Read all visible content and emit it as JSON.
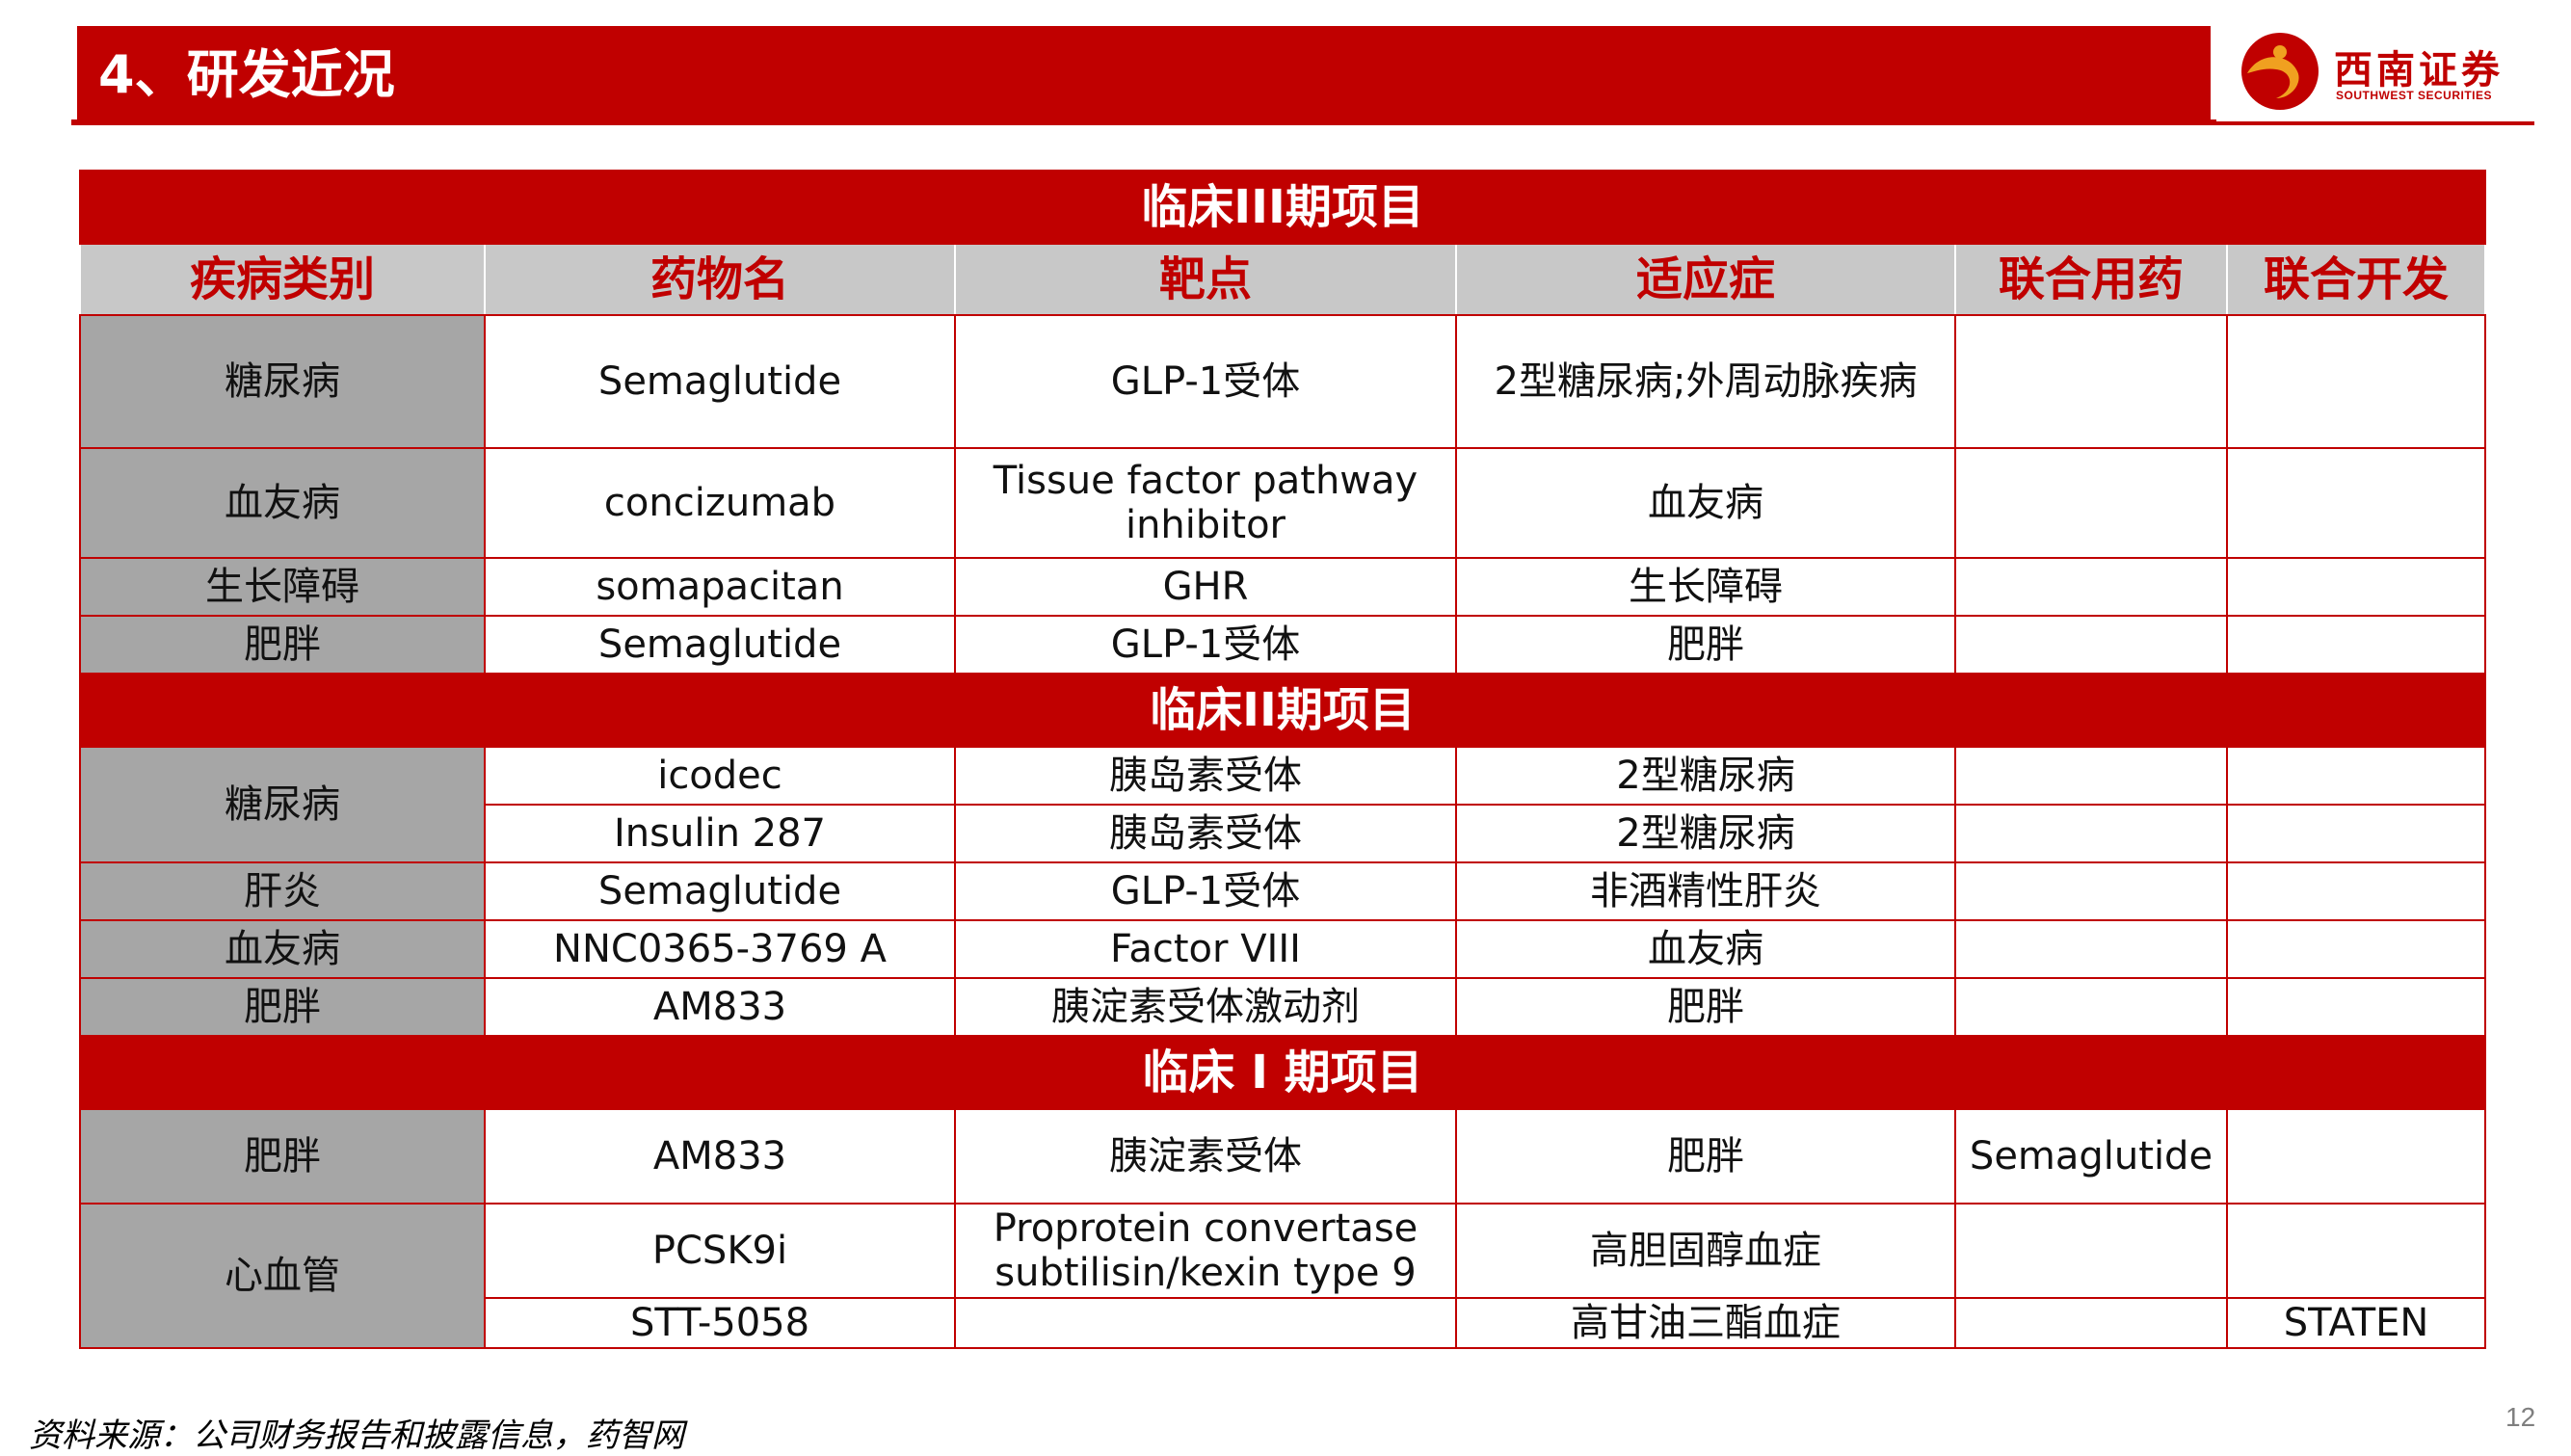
{
  "header": {
    "title": "4、研发近况",
    "logo_cn": "西南证券",
    "logo_en": "SOUTHWEST SECURITIES"
  },
  "table": {
    "columns": [
      "疾病类别",
      "药物名",
      "靶点",
      "适应症",
      "联合用药",
      "联合开发"
    ],
    "phases": [
      {
        "label": "临床III期项目",
        "rows": [
          {
            "category": "糖尿病",
            "drug": "Semaglutide",
            "target": "GLP-1受体",
            "indication": "2型糖尿病;外周动脉疾病",
            "combo": "",
            "partner": ""
          },
          {
            "category": "血友病",
            "drug": "concizumab",
            "target": "Tissue factor pathway inhibitor",
            "indication": "血友病",
            "combo": "",
            "partner": ""
          },
          {
            "category": "生长障碍",
            "drug": "somapacitan",
            "target": "GHR",
            "indication": "生长障碍",
            "combo": "",
            "partner": ""
          },
          {
            "category": "肥胖",
            "drug": "Semaglutide",
            "target": "GLP-1受体",
            "indication": "肥胖",
            "combo": "",
            "partner": ""
          }
        ]
      },
      {
        "label": "临床II期项目",
        "rows": [
          {
            "category": "糖尿病",
            "drug": "icodec",
            "target": "胰岛素受体",
            "indication": "2型糖尿病",
            "combo": "",
            "partner": ""
          },
          {
            "category": "",
            "drug": "Insulin 287",
            "target": "胰岛素受体",
            "indication": "2型糖尿病",
            "combo": "",
            "partner": ""
          },
          {
            "category": "肝炎",
            "drug": "Semaglutide",
            "target": "GLP-1受体",
            "indication": "非酒精性肝炎",
            "combo": "",
            "partner": ""
          },
          {
            "category": "血友病",
            "drug": "NNC0365-3769 A",
            "target": "Factor VIII",
            "indication": "血友病",
            "combo": "",
            "partner": ""
          },
          {
            "category": "肥胖",
            "drug": "AM833",
            "target": "胰淀素受体激动剂",
            "indication": "肥胖",
            "combo": "",
            "partner": ""
          }
        ]
      },
      {
        "label": "临床 I 期项目",
        "rows": [
          {
            "category": "肥胖",
            "drug": "AM833",
            "target": "胰淀素受体",
            "indication": "肥胖",
            "combo": "Semaglutide",
            "partner": ""
          },
          {
            "category": "心血管",
            "drug": "PCSK9i",
            "target": "Proprotein convertase subtilisin/kexin type 9",
            "indication": "高胆固醇血症",
            "combo": "",
            "partner": ""
          },
          {
            "category": "",
            "drug": "STT-5058",
            "target": "",
            "indication": "高甘油三酯血症",
            "combo": "",
            "partner": "STATEN"
          }
        ]
      }
    ]
  },
  "footer": {
    "source": "资料来源：公司财务报告和披露信息，药智网",
    "page_number": "12"
  },
  "colors": {
    "brand_red": "#c00000",
    "header_gray": "#c8c8c8",
    "category_gray": "#a6a6a6"
  }
}
